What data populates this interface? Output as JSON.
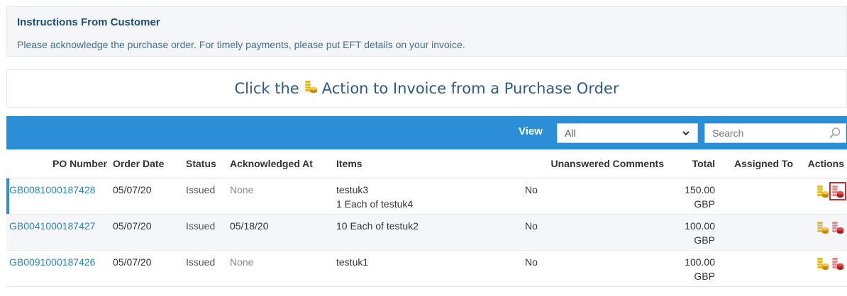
{
  "instructions": {
    "title": "Instructions From Customer",
    "body": "Please acknowledge the purchase order. For timely payments, please put EFT details on your invoice."
  },
  "invoice_hint": {
    "prefix": "Click the",
    "suffix": "Action to Invoice from a Purchase Order",
    "icon": "coins-gold-icon"
  },
  "toolbar": {
    "view_label": "View",
    "view_selected": "All",
    "search_placeholder": "Search"
  },
  "table": {
    "columns": [
      "PO Number",
      "Order Date",
      "Status",
      "Acknowledged At",
      "Items",
      "Unanswered Comments",
      "Total",
      "Assigned To",
      "Actions"
    ],
    "rows": [
      {
        "po_number": "GB0081000187428",
        "order_date": "05/07/20",
        "status": "Issued",
        "acknowledged_at": "None",
        "items": [
          "testuk3",
          "1 Each of testuk4"
        ],
        "unanswered_comments": "No",
        "total_amount": "150.00",
        "total_currency": "GBP",
        "assigned_to": ""
      },
      {
        "po_number": "GB0041000187427",
        "order_date": "05/07/20",
        "status": "Issued",
        "acknowledged_at": "05/18/20",
        "items": [
          "10 Each of testuk2"
        ],
        "unanswered_comments": "No",
        "total_amount": "100.00",
        "total_currency": "GBP",
        "assigned_to": ""
      },
      {
        "po_number": "GB0091000187426",
        "order_date": "05/07/20",
        "status": "Issued",
        "acknowledged_at": "None",
        "items": [
          "testuk1"
        ],
        "unanswered_comments": "No",
        "total_amount": "100.00",
        "total_currency": "GBP",
        "assigned_to": ""
      }
    ]
  },
  "colors": {
    "accent": "#2a8fd6",
    "link": "#2a86c7",
    "title": "#1f4f79",
    "coin_gold": "#e8b62a",
    "coin_red": "#d93a3a",
    "highlight": "#d32f2f"
  },
  "icons": {
    "invoice_action": "coins-gold-icon",
    "credit_memo_action": "coins-red-icon",
    "search": "search-icon",
    "dropdown": "chevron-down-icon"
  }
}
